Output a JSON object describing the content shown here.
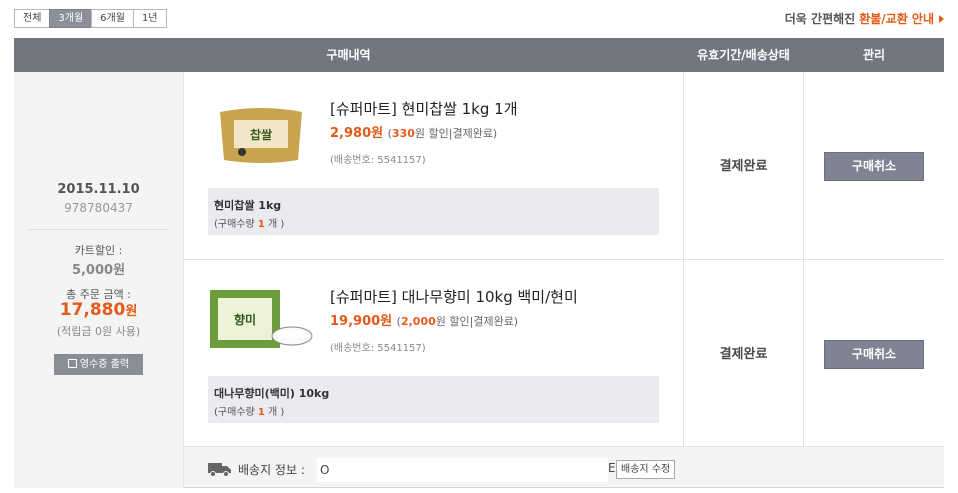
{
  "tabs": [
    "전체",
    "3개월",
    "6개월",
    "1년"
  ],
  "active_tab": "3개월",
  "notice": {
    "prefix": "더욱 간편해진",
    "link": "환불/교환 안내"
  },
  "header": {
    "col_main": "구매내역",
    "col_status": "유효기간/배송상태",
    "col_manage": "관리"
  },
  "order": {
    "date": "2015.11.10",
    "number": "978780437",
    "card_discount_label": "카트할인 :",
    "card_discount_value": "5,000원",
    "total_label": "총 주문 금액 :",
    "total_amount": "17,880",
    "total_unit": "원",
    "points": "(적립금 0원 사용)",
    "receipt_button": "영수증 출력"
  },
  "items": [
    {
      "name": "[슈퍼마트] 현미찹쌀 1kg 1개",
      "price": "2,980원",
      "detail_open": "(",
      "discount": "330",
      "detail_rest": "원 할인|결제완료)",
      "ship_no": "(배송번호: 5541157)",
      "option_name": "현미찹쌀 1kg",
      "qty_prefix": "(구매수량",
      "qty": "1",
      "qty_suffix": "개 )",
      "status": "결제완료",
      "cancel": "구매취소",
      "thumb_colors": {
        "bag": "#c9a44f",
        "label": "#f1e6c8",
        "text": "#3c5a1e"
      }
    },
    {
      "name": "[슈퍼마트] 대나무향미 10kg 백미/현미",
      "price": "19,900원",
      "detail_open": "(",
      "discount": "2,000",
      "detail_rest": "원 할인|결제완료)",
      "ship_no": "(배송번호: 5541157)",
      "option_name": "대나무향미(백미) 10kg",
      "qty_prefix": "(구매수량",
      "qty": "1",
      "qty_suffix": "개 )",
      "status": "결제완료",
      "cancel": "구매취소",
      "thumb_colors": {
        "bag": "#6d9c3a",
        "label": "#eef2d8",
        "text": "#2c5a1a"
      }
    }
  ],
  "shipping": {
    "label": "배송지 정보 :",
    "address": "O",
    "tail": "E",
    "edit_button": "배송지 수정"
  },
  "colors": {
    "accent": "#e35b1b",
    "header_bg": "#73767f",
    "button_bg": "#7f8392"
  }
}
